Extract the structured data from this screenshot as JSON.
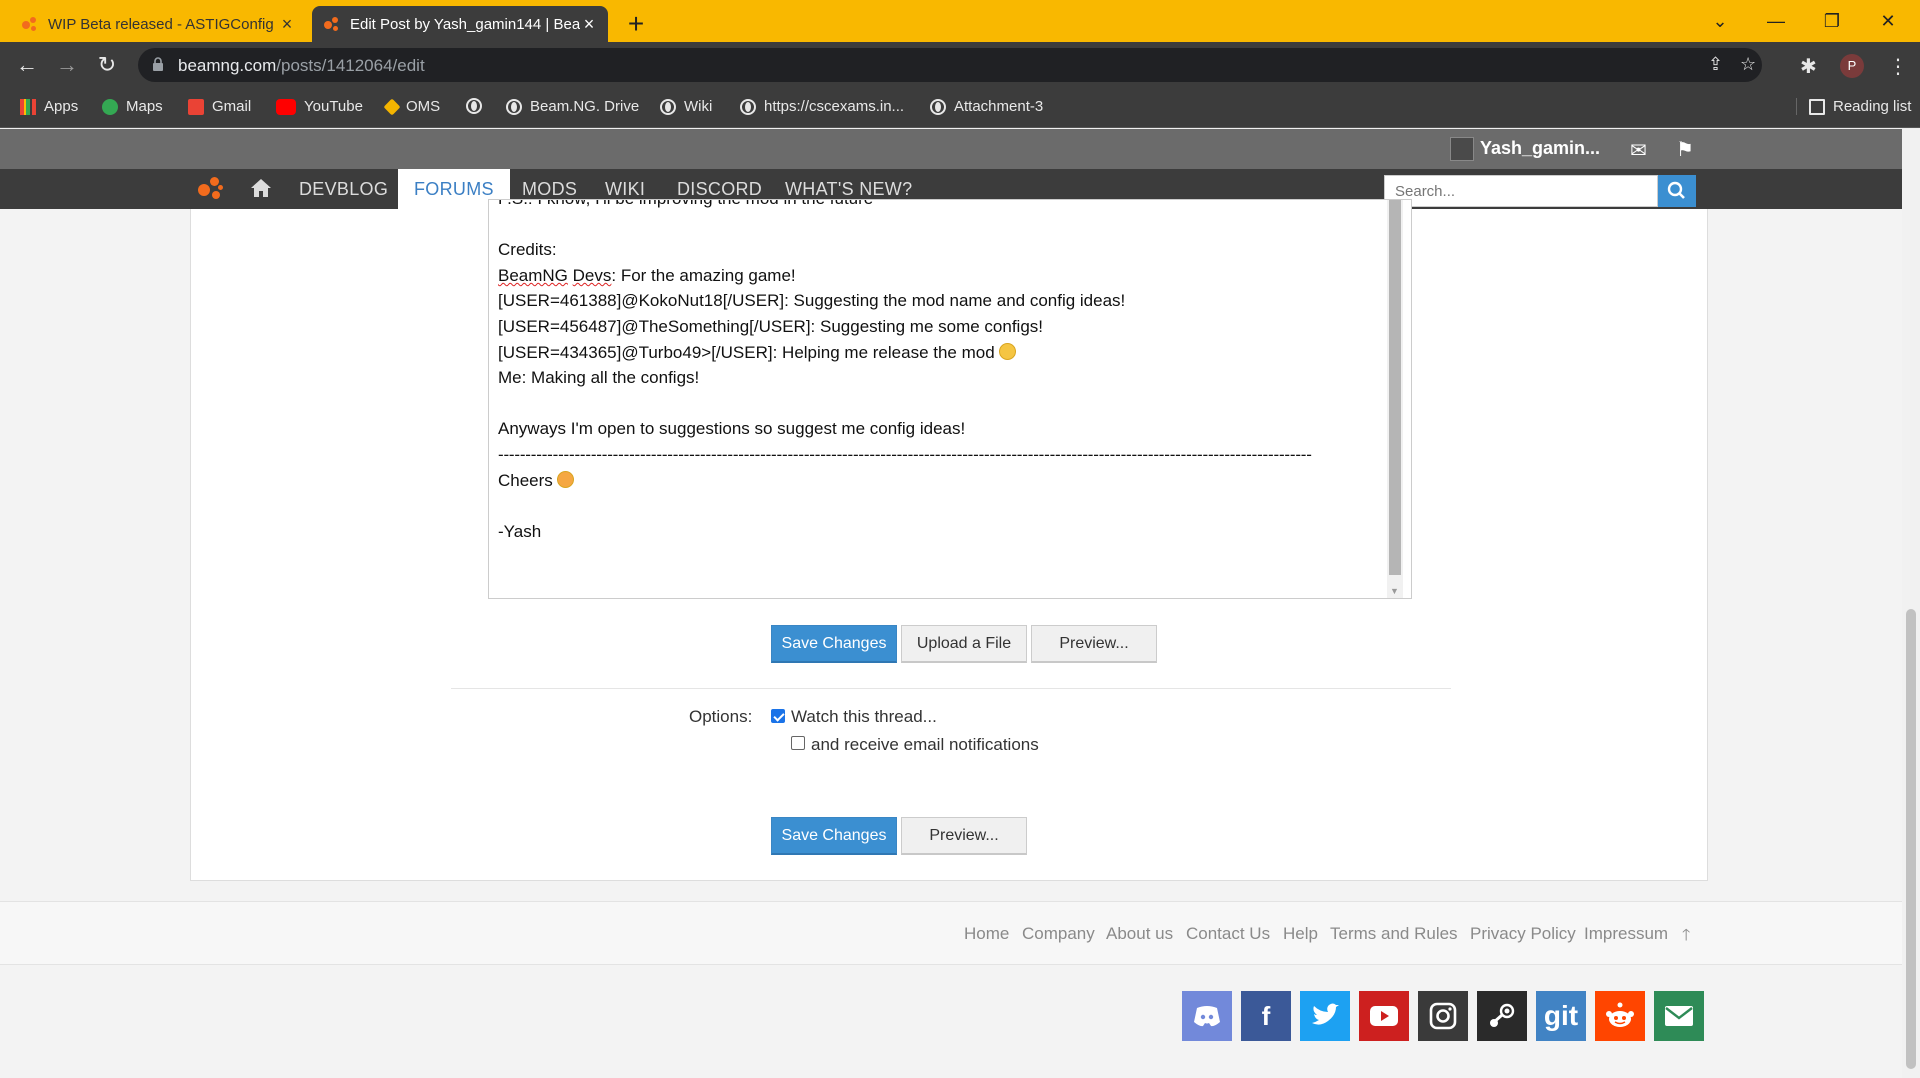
{
  "browser": {
    "tabs": [
      {
        "title": "WIP Beta released - ASTIGConfig",
        "active": false
      },
      {
        "title": "Edit Post by Yash_gamin144 | Bea",
        "active": true
      }
    ],
    "url_domain": "beamng.com",
    "url_path": "/posts/1412064/edit",
    "profile_initial": "P",
    "bookmarks": [
      "Apps",
      "Maps",
      "Gmail",
      "YouTube",
      "OMS",
      "",
      "Beam.NG. Drive",
      "Wiki",
      "https://cscexams.in...",
      "Attachment-3"
    ],
    "reading_list": "Reading list"
  },
  "site": {
    "username": "Yash_gamin...",
    "nav": [
      "DEVBLOG",
      "FORUMS",
      "MODS",
      "WIKI",
      "DISCORD",
      "WHAT'S NEW?"
    ],
    "active_nav": "FORUMS",
    "search_placeholder": "Search..."
  },
  "editor": {
    "top_cut_line": "P.S.: I know, I'll be improving the mod in the future",
    "credits_heading": "Credits:",
    "credit_1_a": "BeamNG",
    "credit_1_b": "Devs",
    "credit_1_c": ": For the amazing game!",
    "credit_2": "[USER=461388]@KokoNut18[/USER]: Suggesting the mod name and config ideas!",
    "credit_3": "[USER=456487]@TheSomething[/USER]: Suggesting me some configs!",
    "credit_4": "[USER=434365]@Turbo49>[/USER]: Helping me release the mod",
    "credit_5": "Me: Making all the configs!",
    "suggestions": "Anyways I'm open to suggestions so suggest me config ideas!",
    "separator": "-----------------------------------------------------------------------------------------------------------------------------------------------------",
    "cheers": "Cheers",
    "signature": "-Yash"
  },
  "buttons": {
    "save_changes": "Save Changes",
    "upload_file": "Upload a File",
    "preview": "Preview..."
  },
  "options": {
    "label": "Options:",
    "watch_thread": "Watch this thread...",
    "watch_checked": true,
    "email_notifications": "and receive email notifications",
    "email_checked": false
  },
  "footer": {
    "links": [
      "Home",
      "Company",
      "About us",
      "Contact Us",
      "Help",
      "Terms and Rules",
      "Privacy Policy",
      "Impressum"
    ]
  },
  "social": [
    {
      "name": "discord",
      "color": "#7289da"
    },
    {
      "name": "facebook",
      "color": "#3b5998"
    },
    {
      "name": "twitter",
      "color": "#1da1f2"
    },
    {
      "name": "youtube",
      "color": "#cd201f"
    },
    {
      "name": "instagram",
      "color": "#3a3a3a"
    },
    {
      "name": "steam",
      "color": "#2a2a2a"
    },
    {
      "name": "git",
      "color": "#4183c4",
      "label": "git"
    },
    {
      "name": "reddit",
      "color": "#ff4500"
    },
    {
      "name": "email",
      "color": "#2e8b57"
    }
  ],
  "colors": {
    "chrome_frame": "#f9b800",
    "accent": "#3b8fd1",
    "brand_orange": "#f26b1d"
  }
}
